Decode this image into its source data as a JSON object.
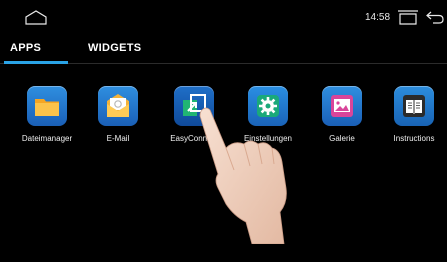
{
  "statusbar": {
    "time": "14:58"
  },
  "tabs": [
    {
      "label": "APPS",
      "active": true
    },
    {
      "label": "WIDGETS",
      "active": false
    }
  ],
  "apps": [
    {
      "label": "Dateimanager",
      "icon": "folder-icon"
    },
    {
      "label": "E-Mail",
      "icon": "mail-icon"
    },
    {
      "label": "EasyConnect",
      "icon": "easyconnect-icon"
    },
    {
      "label": "Einstellungen",
      "icon": "gear-icon"
    },
    {
      "label": "Galerie",
      "icon": "image-icon"
    },
    {
      "label": "Instructions",
      "icon": "book-icon"
    }
  ],
  "colors": {
    "background": "#000000",
    "accent": "#2aa3e6",
    "tile": "#1f6fc8"
  }
}
